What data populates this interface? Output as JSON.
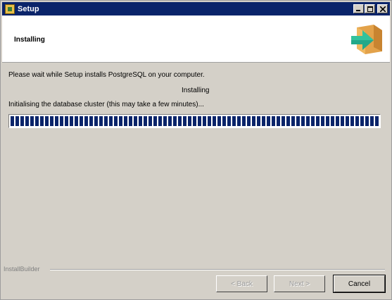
{
  "window": {
    "title": "Setup",
    "controls": [
      "minimize-icon",
      "maximize-icon",
      "close-icon"
    ]
  },
  "header": {
    "title": "Installing",
    "logo_icon": "installer-arrow-box-icon"
  },
  "main": {
    "intro": "Please wait while Setup installs PostgreSQL on your computer.",
    "status": "Installing",
    "detail": "Initialising the database cluster (this may take a few minutes)...",
    "progress": 1.0
  },
  "footer": {
    "brand": "InstallBuilder",
    "back_label": "< Back",
    "next_label": "Next >",
    "cancel_label": "Cancel"
  },
  "colors": {
    "titlebar": "#0a246a",
    "progress": "#0a246a",
    "face": "#d4d0c8"
  }
}
